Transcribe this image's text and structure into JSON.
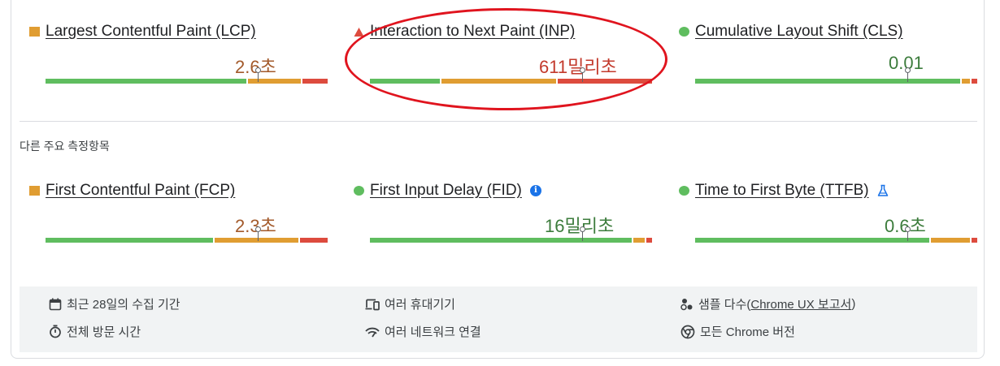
{
  "core_metrics": [
    {
      "id": "lcp",
      "name": "Largest Contentful Paint (LCP)",
      "value": "2.6초",
      "status": "average",
      "marker": "square",
      "distribution": {
        "good": 0.72,
        "average": 0.19,
        "poor": 0.09
      },
      "p75_position": 0.75
    },
    {
      "id": "inp",
      "name": "Interaction to Next Paint (INP)",
      "value": "611밀리초",
      "status": "poor",
      "marker": "triangle",
      "distribution": {
        "good": 0.25,
        "average": 0.41,
        "poor": 0.34
      },
      "p75_position": 0.75
    },
    {
      "id": "cls",
      "name": "Cumulative Layout Shift (CLS)",
      "value": "0.01",
      "status": "good",
      "marker": "circle",
      "distribution": {
        "good": 0.95,
        "average": 0.03,
        "poor": 0.02
      },
      "p75_position": 0.75
    }
  ],
  "other_heading": "다른 주요 측정항목",
  "other_metrics": [
    {
      "id": "fcp",
      "name": "First Contentful Paint (FCP)",
      "value": "2.3초",
      "status": "average",
      "marker": "square",
      "distribution": {
        "good": 0.6,
        "average": 0.3,
        "poor": 0.1
      },
      "p75_position": 0.75,
      "badge": ""
    },
    {
      "id": "fid",
      "name": "First Input Delay (FID)",
      "value": "16밀리초",
      "status": "good",
      "marker": "circle",
      "distribution": {
        "good": 0.94,
        "average": 0.04,
        "poor": 0.02
      },
      "p75_position": 0.75,
      "badge": "info-icon"
    },
    {
      "id": "ttfb",
      "name": "Time to First Byte (TTFB)",
      "value": "0.6초",
      "status": "good",
      "marker": "circle",
      "distribution": {
        "good": 0.84,
        "average": 0.14,
        "poor": 0.02
      },
      "p75_position": 0.75,
      "badge": "flask-icon"
    }
  ],
  "footer": {
    "collection_period": "최근 28일의 수집 기간",
    "duration": "전체 방문 시간",
    "devices": "여러 휴대기기",
    "network": "여러 네트워크 연결",
    "samples_prefix": "샘플 다수(",
    "samples_link": "Chrome UX 보고서",
    "samples_suffix": ")",
    "versions": "모든 Chrome 버전"
  },
  "colors": {
    "good": "#5fbd5f",
    "average": "#e09d32",
    "poor": "#dd4b3e",
    "highlight": "#e0141e"
  }
}
